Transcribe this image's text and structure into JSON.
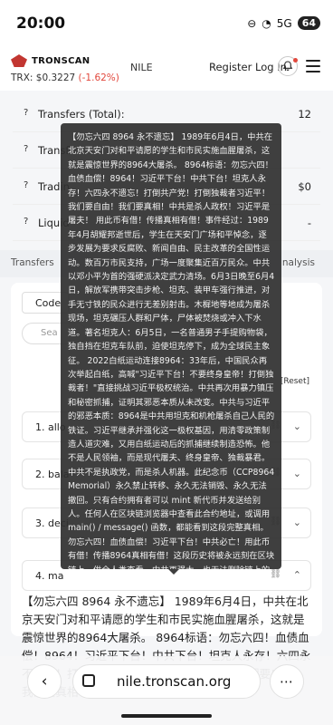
{
  "status_bar": {
    "time": "20:00",
    "network": "5G",
    "battery": "64"
  },
  "header": {
    "logo_text": "TRONSCAN",
    "trx_label": "TRX: $0.3227",
    "trx_change": "(-1.62%)",
    "network_name": "NILE",
    "login_label": "Register Log In"
  },
  "stats": [
    {
      "label": "Transfers (Total):",
      "value": "12"
    },
    {
      "label": "Transf",
      "value": ""
    },
    {
      "label": "Tradin",
      "value": "$0"
    },
    {
      "label": "Liquid",
      "value": "-"
    }
  ],
  "tabs": {
    "left": "Transfers",
    "right": "nalysis"
  },
  "contract": {
    "code_label": "Code",
    "search_placeholder": "Sea",
    "reset_label": "[Reset]",
    "functions": [
      {
        "label": "1. allo"
      },
      {
        "label": "2. bala"
      },
      {
        "label": "3. deci"
      },
      {
        "label": "4. ma"
      }
    ],
    "body_text": "【勿忘六四 8964 永不遗忘】 1989年6月4日，中共在北京天安门对和平请愿的学生和市民实施血腥屠杀，这就是震惊世界的8964大屠杀。 8964标语：勿忘六四！血债血偿！8964！习近平下台！中共下台！坦克人永存！六四永不遗忘！打倒共产党！打倒独裁者习近平！我们要自由！我们要真相！中共是杀人政权！习近平是屠夫！"
  },
  "tooltip": {
    "text": "【勿忘六四 8964 永不遗忘】 1989年6月4日，中共在北京天安门对和平请愿的学生和市民实施血腥屠杀，这就是震惊世界的8964大屠杀。 8964标语：勿忘六四！血债血偿！8964！习近平下台！中共下台！坦克人永存！六四永不遗忘！打倒共产党！打倒独裁者习近平！我们要自由！我们要真相！中共是杀人政权！习近平是屠夫！ 用此币有借！传播真相有借！事件经过：1989年4月胡耀邦逝世后，学生在天安门广场和平悼念，逐步发展为要求反腐败、新闻自由、民主改革的全国性运动。数百万市民支持，广场一度聚集近百万民众。中共以邓小平为首的强硬派决定武力清场。6月3日晚至6月4日，解放军携带突击步枪、坦克、装甲车强行推进，对手无寸铁的民众进行无差别射击。木樨地等地成为屠杀现场，坦克碾压人群和尸体，尸体被焚烧或冲入下水道。著名坦克人：6月5日，一名普通男子手提购物袋，独自挡在坦克车队前，迫使坦克停下，成为全球民主象征。 2022白纸运动连接8964：33年后，中国民众再次举起白纸，高喊\"习近平下台！不要终身皇帝！打倒独裁者！\"直接挑战习近平极权统治。中共再次用暴力镇压和秘密抓捕，证明其邪恶本质从未改变。中共与习近平的邪恶本质：8964是中共用坦克和机枪屠杀自己人民的铁证。习近平继承并强化这一极权基因，用清零政策制造人道灾难，又用白纸运动后的抓捕继续制造恐怖。他不是人民领袖，而是现代屠夫、终身皇帝、独裁暴君。中共不是执政党，而是杀人机器。此纪念币（CCP8964Memorial）永久禁止转移、永久无法销毁、永久无法撤回。只有合约拥有者可以 mint 新代币并发送给别人。任何人在区块链浏览器中查看此合约地址，或调用 main() / message() 函数，都能看到这段完整真相。勿忘六四！血债血偿！习近平下台！中共必亡！用此币有借！传播8964真相有借！这段历史将被永远刻在区块链上，供全人类查看。中共再强大，也无法删除链上的真相。"
  },
  "browser_bar": {
    "url": "nile.tronscan.org",
    "back_glyph": "‹",
    "more_glyph": "⋯"
  },
  "colors": {
    "brand_red": "#c23631",
    "negative_change": "#e2483d",
    "tooltip_bg": "#303030"
  }
}
